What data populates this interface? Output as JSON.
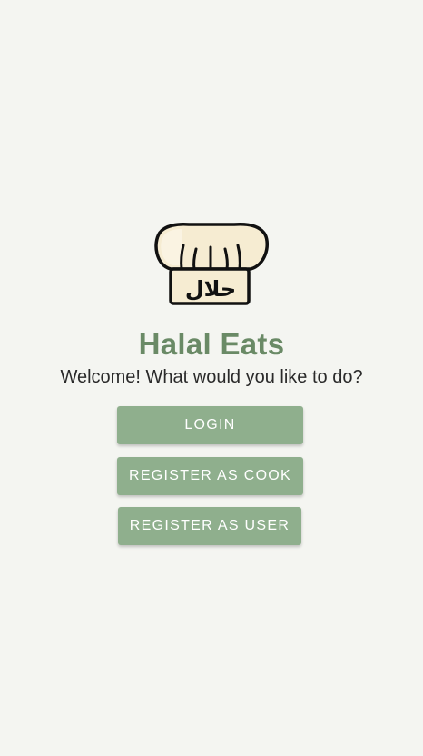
{
  "app": {
    "title": "Halal Eats",
    "welcome": "Welcome! What would you like to do?",
    "logo_icon": "chef-hat-halal-icon",
    "logo_text": "حلال"
  },
  "actions": {
    "login_label": "LOGIN",
    "register_cook_label": "REGISTER AS COOK",
    "register_user_label": "REGISTER AS USER"
  },
  "colors": {
    "background": "#f4f5f1",
    "title": "#6a8a66",
    "button": "#8faf8d",
    "button_text": "#ffffff",
    "hat_fill": "#f6ecd2"
  }
}
